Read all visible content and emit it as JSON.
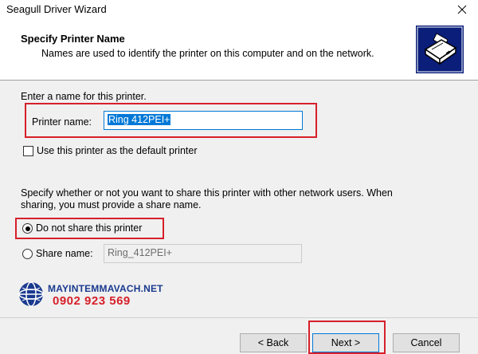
{
  "window": {
    "title": "Seagull Driver Wizard"
  },
  "header": {
    "title": "Specify Printer Name",
    "subtitle": "Names are used to identify the printer on this computer and on the network."
  },
  "name_section": {
    "intro": "Enter a name for this printer.",
    "printer_name_label": "Printer name:",
    "printer_name_value": "Ring 412PEI+",
    "default_checkbox_label": "Use this printer as the default printer",
    "default_checked": false
  },
  "share_section": {
    "intro_line1": "Specify whether or not you want to share this printer with other network users.  When",
    "intro_line2": "sharing, you must provide a share name.",
    "no_share_label": "Do not share this printer",
    "share_label": "Share name:",
    "share_name_value": "Ring_412PEI+",
    "selected": "no_share"
  },
  "watermark": {
    "brand": "MAYINTEMMAVACH.NET",
    "phone": "0902 923 569"
  },
  "buttons": {
    "back": "< Back",
    "next": "Next >",
    "cancel": "Cancel"
  },
  "colors": {
    "highlight": "#d6202a",
    "selection": "#0078d7",
    "brand_blue": "#1a3a8f"
  },
  "icons": {
    "close": "close-icon",
    "header": "printer-icon",
    "watermark": "globe-icon"
  }
}
